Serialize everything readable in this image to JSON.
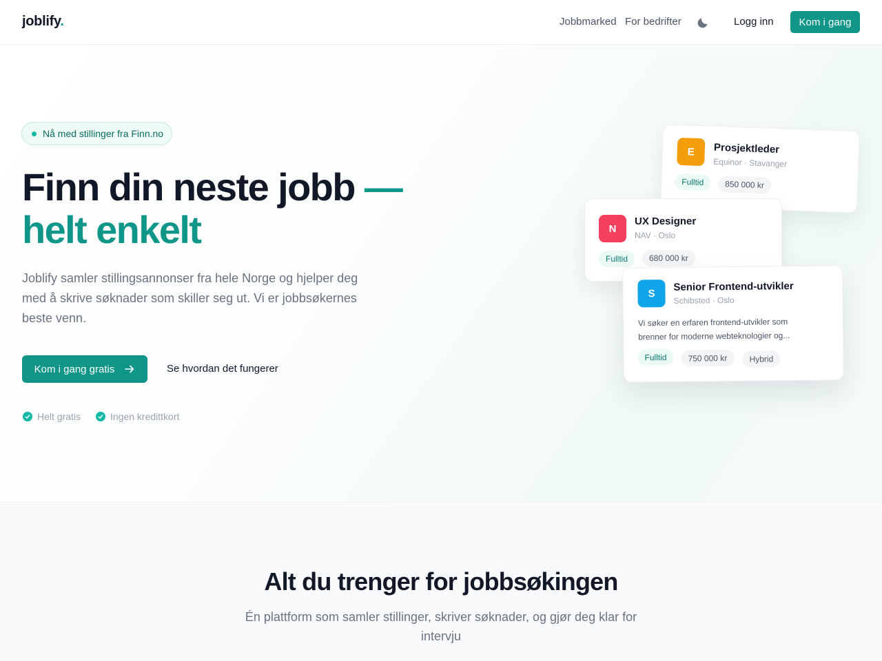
{
  "header": {
    "logo": "joblify",
    "logo_dot": ".",
    "nav": [
      "Jobbmarked",
      "For bedrifter"
    ],
    "login": "Logg inn",
    "cta": "Kom i gang",
    "theme_icon": "moon-icon"
  },
  "hero": {
    "badge": "Nå med stillinger fra Finn.no",
    "title_line1": "Finn din neste jobb",
    "title_dash": "—",
    "title_line2": "helt enkelt",
    "lead": "Joblify samler stillingsannonser fra hele Norge og hjelper deg med å skrive søknader som skiller seg ut. Vi er jobbsøkernes beste venn.",
    "primary_cta": "Kom i gang gratis",
    "secondary_cta": "Se hvordan det fungerer",
    "features": [
      "Helt gratis",
      "Ingen kredittkort"
    ]
  },
  "jobs": [
    {
      "initial": "E",
      "title": "Prosjektleder",
      "company": "Equinor · Stavanger",
      "type": "Fulltid",
      "salary": "850 000 kr",
      "color": "#f59e0b"
    },
    {
      "initial": "N",
      "title": "UX Designer",
      "company": "NAV · Oslo",
      "type": "Fulltid",
      "salary": "680 000 kr",
      "color": "#f43f5e"
    },
    {
      "initial": "S",
      "title": "Senior Frontend-utvikler",
      "company": "Schibsted · Oslo",
      "description": "Vi søker en erfaren frontend-utvikler som brenner for moderne webteknologier og...",
      "type": "Fulltid",
      "salary": "750 000 kr",
      "mode": "Hybrid",
      "color": "#0ea5e9"
    }
  ],
  "section": {
    "title": "Alt du trenger for jobbsøkingen",
    "subtitle": "Én plattform som samler stillinger, skriver søknader, og gjør deg klar for intervju"
  },
  "colors": {
    "accent": "#0f9688",
    "text": "#111827",
    "muted": "#6b7280"
  }
}
